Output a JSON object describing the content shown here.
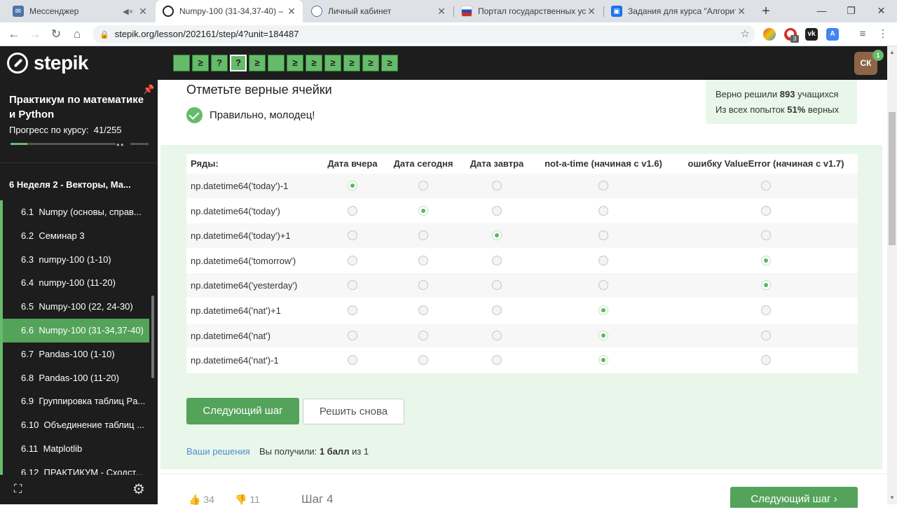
{
  "browser": {
    "tabs": [
      {
        "title": "Мессенджер",
        "favicon": "vk-messenger-icon"
      },
      {
        "title": "Numpy-100 (31-34,37-40) – Ш",
        "favicon": "stepik-icon"
      },
      {
        "title": "Личный кабинет",
        "favicon": "globe-icon"
      },
      {
        "title": "Портал государственных услу",
        "favicon": "russia-flag-icon"
      },
      {
        "title": "Задания для курса \"Алгоритм",
        "favicon": "classroom-icon"
      }
    ],
    "url": "stepik.org/lesson/202161/step/4?unit=184487",
    "extension_badge": "3"
  },
  "header": {
    "logo": "stepik",
    "steps": [
      {
        "type": "text",
        "glyph": ""
      },
      {
        "type": "code",
        "glyph": "≥"
      },
      {
        "type": "quiz",
        "glyph": "?"
      },
      {
        "type": "quiz",
        "glyph": "?"
      },
      {
        "type": "code",
        "glyph": "≥"
      },
      {
        "type": "text",
        "glyph": ""
      },
      {
        "type": "code",
        "glyph": "≥"
      },
      {
        "type": "code",
        "glyph": "≥"
      },
      {
        "type": "code",
        "glyph": "≥"
      },
      {
        "type": "code",
        "glyph": "≥"
      },
      {
        "type": "code",
        "glyph": "≥"
      },
      {
        "type": "code",
        "glyph": "≥"
      }
    ],
    "avatar_initials": "СК",
    "avatar_badge": "1"
  },
  "sidebar": {
    "course_title": "Практикум по математике и Python",
    "progress_label": "Прогресс по курсу:",
    "progress_value": "41/255",
    "progress_fraction": 0.161,
    "module": "6  Неделя 2 - Векторы, Ма...",
    "lessons": [
      {
        "num": "6.1",
        "title": "Numpy (основы, справ..."
      },
      {
        "num": "6.2",
        "title": "Семинар 3"
      },
      {
        "num": "6.3",
        "title": "numpy-100 (1-10)"
      },
      {
        "num": "6.4",
        "title": "numpy-100 (11-20)"
      },
      {
        "num": "6.5",
        "title": "Numpy-100 (22, 24-30)"
      },
      {
        "num": "6.6",
        "title": "Numpy-100 (31-34,37-40)"
      },
      {
        "num": "6.7",
        "title": "Pandas-100 (1-10)"
      },
      {
        "num": "6.8",
        "title": "Pandas-100 (11-20)"
      },
      {
        "num": "6.9",
        "title": "Группировка таблиц Pa..."
      },
      {
        "num": "6.10",
        "title": "Объединение таблиц ..."
      },
      {
        "num": "6.11",
        "title": "Matplotlib"
      },
      {
        "num": "6.12",
        "title": "ПРАКТИКУМ - Сходст..."
      }
    ],
    "active_lesson": 5
  },
  "main": {
    "question_title": "Отметьте верные ячейки",
    "feedback": "Правильно, молодец!",
    "stats": {
      "solved_prefix": "Верно решили",
      "solved_count": "893",
      "solved_suffix": "учащихся",
      "attempts_prefix": "Из всех попыток",
      "attempts_percent": "51%",
      "attempts_suffix": "верных"
    },
    "table": {
      "headers": [
        "Ряды:",
        "Дата вчера",
        "Дата сегодня",
        "Дата завтра",
        "not-a-time (начиная с v1.6)",
        "ошибку ValueError (начиная с v1.7)"
      ],
      "rows": [
        {
          "label": "np.datetime64('today')-1",
          "selected": 0
        },
        {
          "label": "np.datetime64('today')",
          "selected": 1
        },
        {
          "label": "np.datetime64('today')+1",
          "selected": 2
        },
        {
          "label": "np.datetime64('tomorrow')",
          "selected": 4
        },
        {
          "label": "np.datetime64('yesterday')",
          "selected": 4
        },
        {
          "label": "np.datetime64('nat')+1",
          "selected": 3
        },
        {
          "label": "np.datetime64('nat')",
          "selected": 3
        },
        {
          "label": "np.datetime64('nat')-1",
          "selected": 3
        }
      ]
    },
    "next_button": "Следующий шаг",
    "retry_button": "Решить снова",
    "solutions_link": "Ваши решения",
    "score_prefix": "Вы получили:",
    "score_value": "1 балл",
    "score_suffix": "из 1"
  },
  "footer": {
    "likes": "34",
    "dislikes": "11",
    "step_label": "Шаг 4",
    "next_button": "Следующий шаг"
  },
  "colors": {
    "accent": "#66bb6a",
    "accent_dark": "#54a35a",
    "header_bg": "#1d1d1d",
    "answer_bg": "#e9f6ea"
  }
}
